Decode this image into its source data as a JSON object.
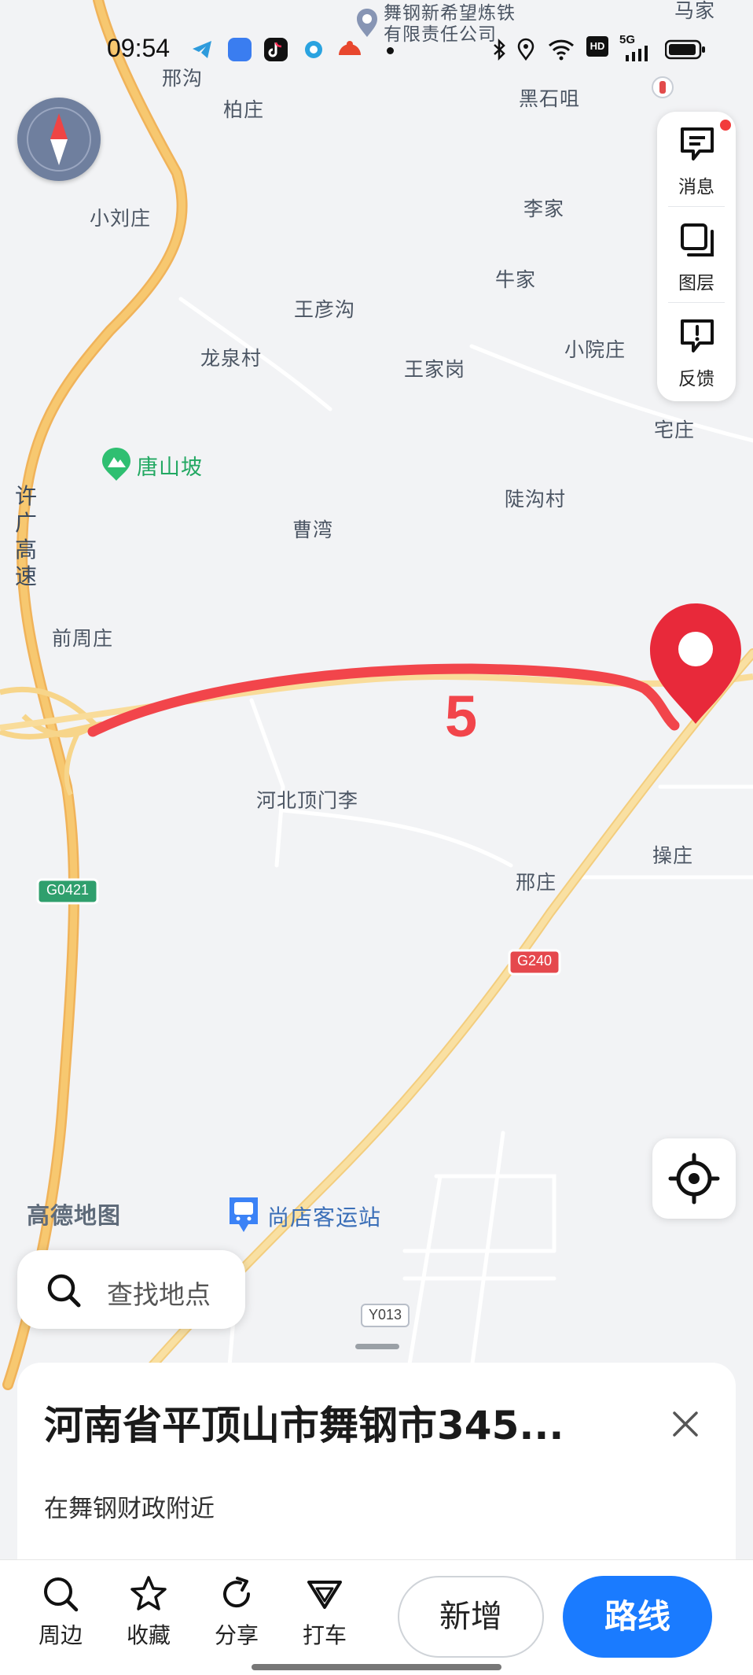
{
  "status_bar": {
    "time": "09:54",
    "network": "5G",
    "hd": "HD"
  },
  "map": {
    "place_labels": [
      {
        "text": "邢沟"
      },
      {
        "text": "柏庄"
      },
      {
        "text": "黑石咀"
      },
      {
        "text": "小刘庄"
      },
      {
        "text": "李家"
      },
      {
        "text": "牛家"
      },
      {
        "text": "王彦沟"
      },
      {
        "text": "龙泉村"
      },
      {
        "text": "王家岗"
      },
      {
        "text": "小院庄"
      },
      {
        "text": "宅庄"
      },
      {
        "text": "陡沟村"
      },
      {
        "text": "曹湾"
      },
      {
        "text": "前周庄"
      },
      {
        "text": "河北顶门李"
      },
      {
        "text": "邢庄"
      },
      {
        "text": "操庄"
      },
      {
        "text": "马家"
      }
    ],
    "company_label_line1": "舞钢新希望炼铁",
    "company_label_line2": "有限责任公司",
    "park_label": "唐山坡",
    "highway_label": [
      "许",
      "广",
      "高",
      "速"
    ],
    "road_shields": {
      "g0421": "G0421",
      "g240": "G240",
      "y013": "Y013"
    },
    "route_number": "5",
    "bus_station_label": "尚店客运站",
    "watermark": "高德地图",
    "colors": {
      "route": "#f2454b",
      "marker": "#e8293a",
      "highway": "#f7c870",
      "accent": "#1a7bff"
    }
  },
  "right_panel": {
    "messages_label": "消息",
    "layers_label": "图层",
    "feedback_label": "反馈"
  },
  "search": {
    "placeholder": "查找地点"
  },
  "place_sheet": {
    "title": "河南省平顶山市舞钢市345...",
    "subtitle": "在舞钢财政附近"
  },
  "bottom_bar": {
    "nearby_label": "周边",
    "favorite_label": "收藏",
    "share_label": "分享",
    "taxi_label": "打车",
    "add_label": "新增",
    "route_label": "路线"
  }
}
